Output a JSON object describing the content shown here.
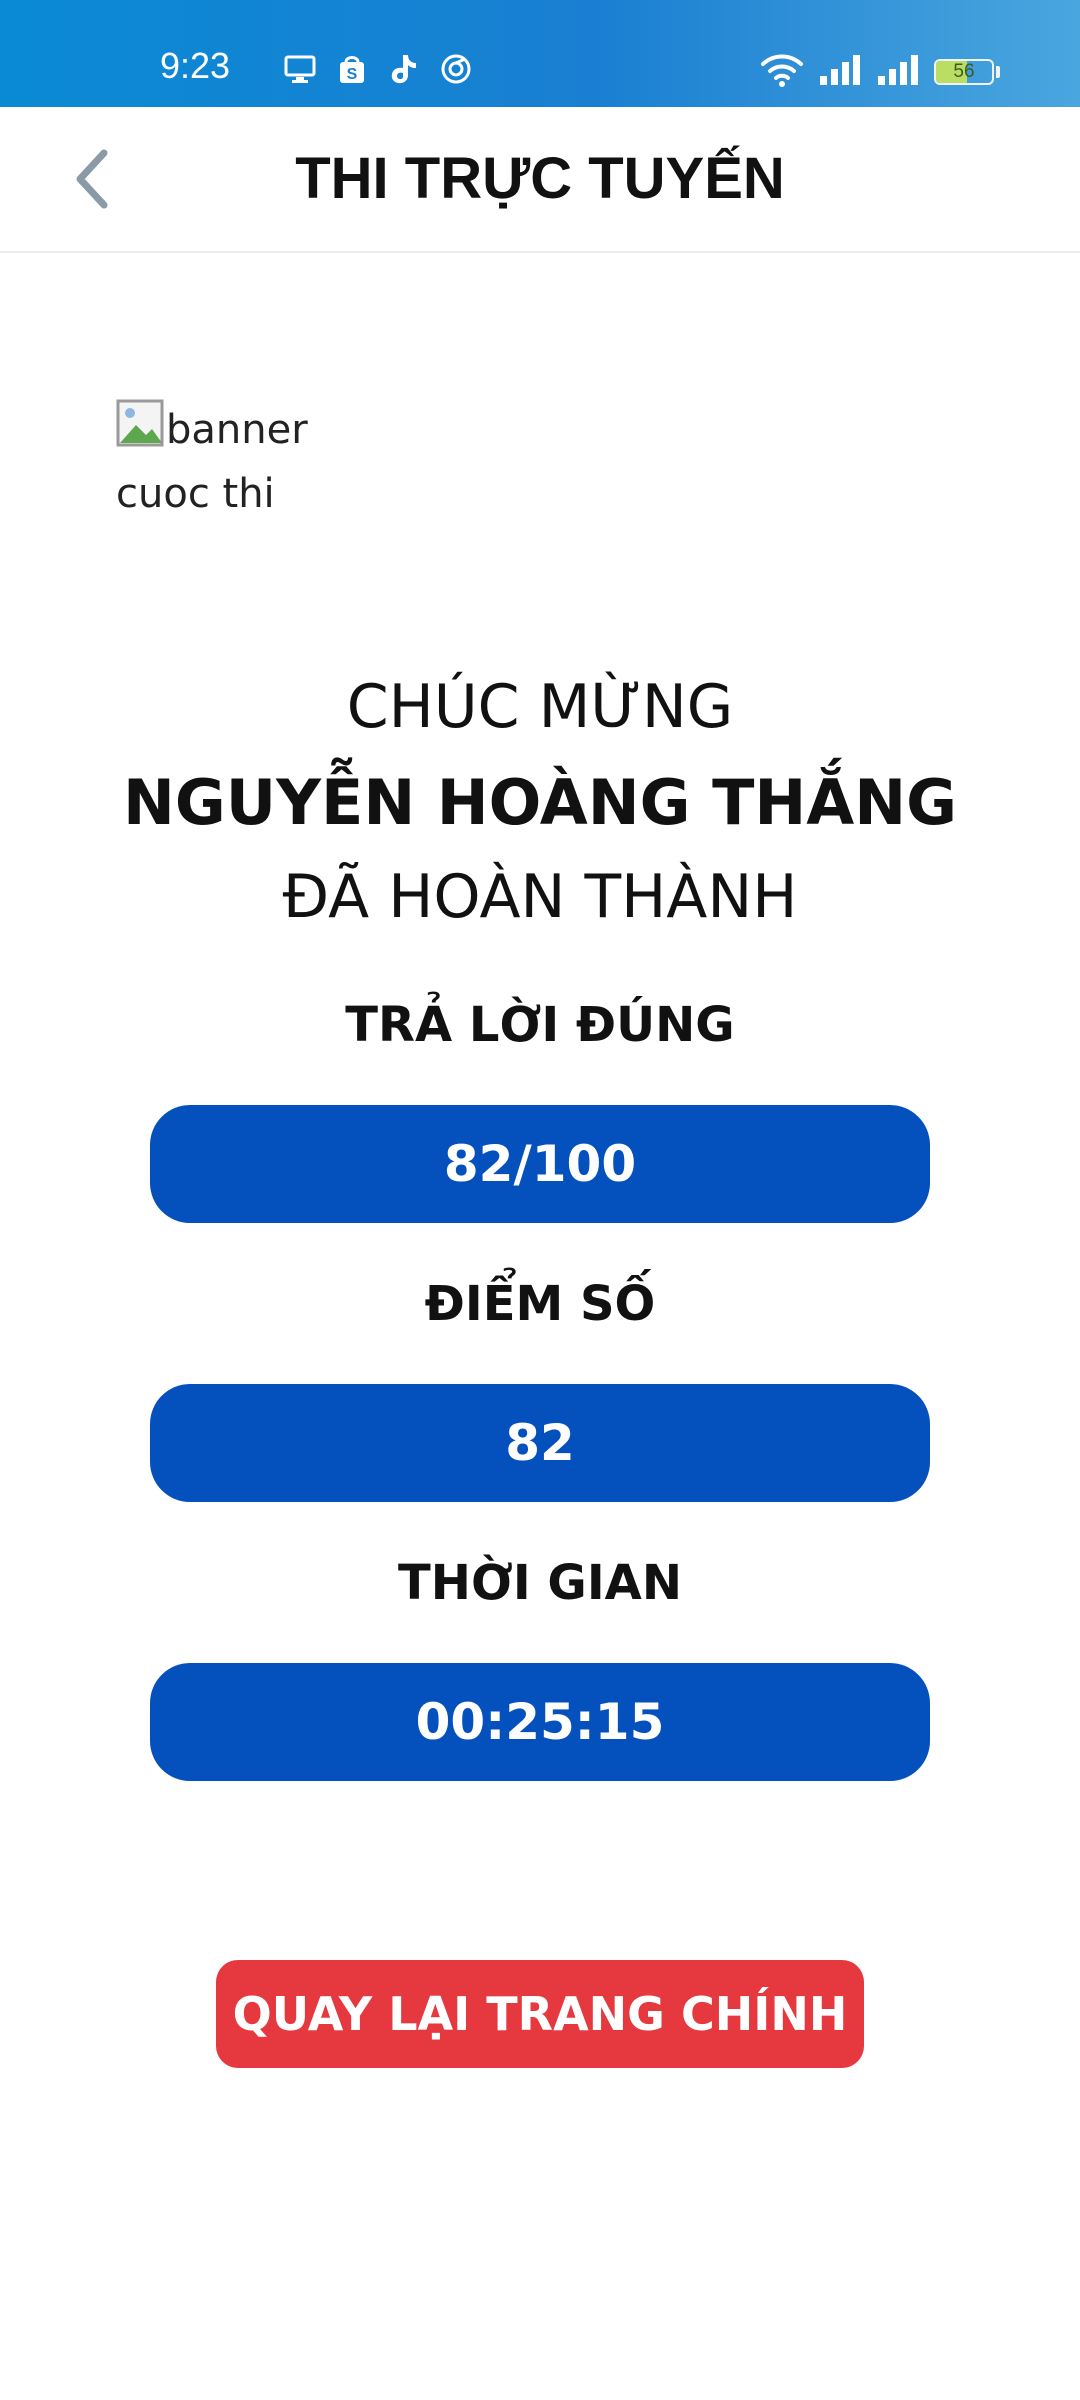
{
  "status_bar": {
    "time": "9:23",
    "battery_level": "56",
    "battery_fraction": 0.56,
    "icons": [
      "screen-cast-icon",
      "shopee-icon",
      "tiktok-icon",
      "browser-icon",
      "wifi-icon",
      "signal-icon",
      "signal-icon",
      "battery-icon"
    ]
  },
  "header": {
    "title": "THI TRỰC TUYẾN",
    "back_icon": "chevron-left-icon"
  },
  "banner": {
    "alt_text": "banner cuoc thi",
    "icon": "broken-image-icon"
  },
  "result": {
    "congrats_line1": "CHÚC MỪNG",
    "name": "NGUYỄN HOÀNG THẮNG",
    "congrats_line3": "ĐÃ HOÀN THÀNH",
    "correct_label": "TRẢ LỜI ĐÚNG",
    "correct_value": "82/100",
    "score_label": "ĐIỂM SỐ",
    "score_value": "82",
    "time_label": "THỜI GIAN",
    "time_value": "00:25:15"
  },
  "actions": {
    "home_button": "QUAY LẠI TRANG CHÍNH"
  },
  "colors": {
    "pill": "#0451be",
    "button": "#e5393f",
    "status_bar": "#1a7fd2"
  }
}
